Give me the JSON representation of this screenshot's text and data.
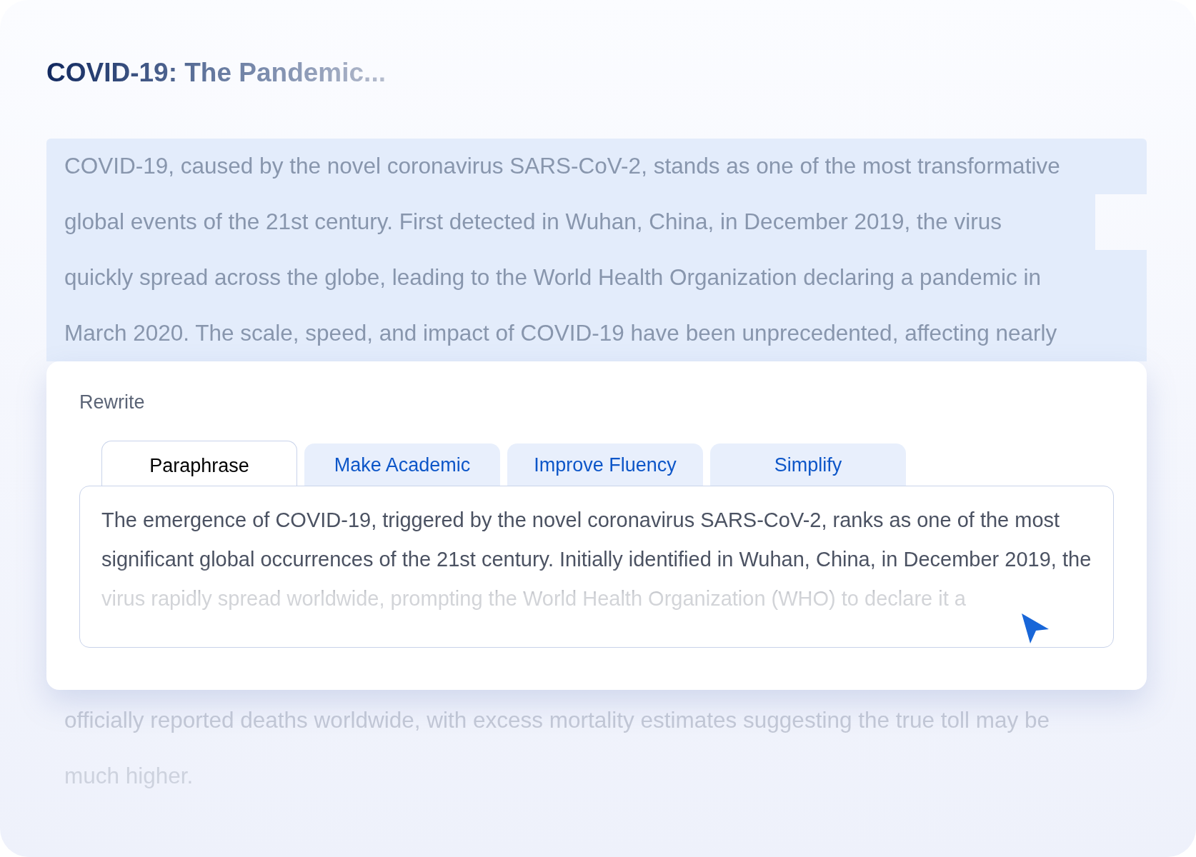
{
  "title": "COVID-19: The Pandemic...",
  "source_lines": [
    "COVID-19, caused by the novel coronavirus SARS-CoV-2, stands as one of the most transformative",
    "global events of the 21st century. First detected in Wuhan, China, in December 2019, the virus",
    "quickly spread across the globe, leading to the World Health Organization declaring a pandemic in",
    "March 2020. The scale, speed, and impact of COVID-19 have been unprecedented, affecting nearly"
  ],
  "rewrite": {
    "label": "Rewrite",
    "tabs": [
      {
        "label": "Paraphrase",
        "selected": true
      },
      {
        "label": "Make Academic",
        "selected": false
      },
      {
        "label": "Improve Fluency",
        "selected": false
      },
      {
        "label": "Simplify",
        "selected": false
      }
    ],
    "result": "The emergence of COVID-19, triggered by the novel coronavirus SARS-CoV-2, ranks as one of the most significant global occurrences of the 21st century. Initially identified in Wuhan, China, in December 2019, the virus rapidly spread worldwide, prompting the World Health Organization (WHO) to declare it a"
  },
  "trailing_lines": [
    "officially reported deaths worldwide, with excess mortality estimates suggesting the true toll may be",
    "much higher."
  ]
}
